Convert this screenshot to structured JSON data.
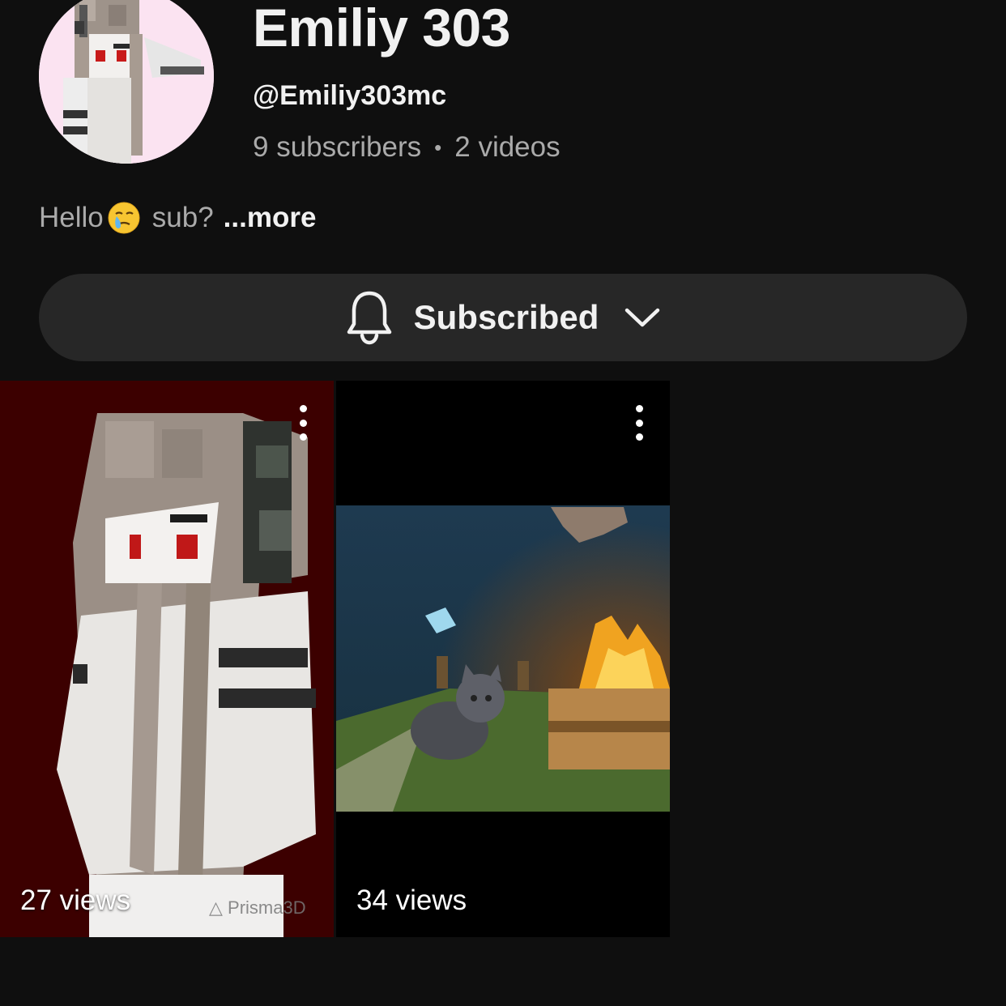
{
  "channel": {
    "name": "Emiliy 303",
    "handle": "@Emiliy303mc",
    "subscribers": "9 subscribers",
    "separator": "•",
    "videos_count": "2 videos",
    "description_pre": "Hello",
    "description_emoji": "face-holding-back-tears",
    "description_post": "sub?",
    "more_label": "...more"
  },
  "subscribe_button": {
    "label": "Subscribed",
    "icon": "bell-icon",
    "dropdown_icon": "chevron-down-icon"
  },
  "videos": [
    {
      "views": "27 views",
      "watermark": "Prisma3D",
      "thumb": "minecraft-skin-girl"
    },
    {
      "views": "34 views",
      "thumb": "minecraft-cat-campfire"
    }
  ],
  "colors": {
    "background": "#0f0f0f",
    "button_bg": "#272727",
    "text_primary": "#f1f1f1",
    "text_secondary": "#aaaaaa",
    "thumb1_bg": "#3c0000"
  }
}
